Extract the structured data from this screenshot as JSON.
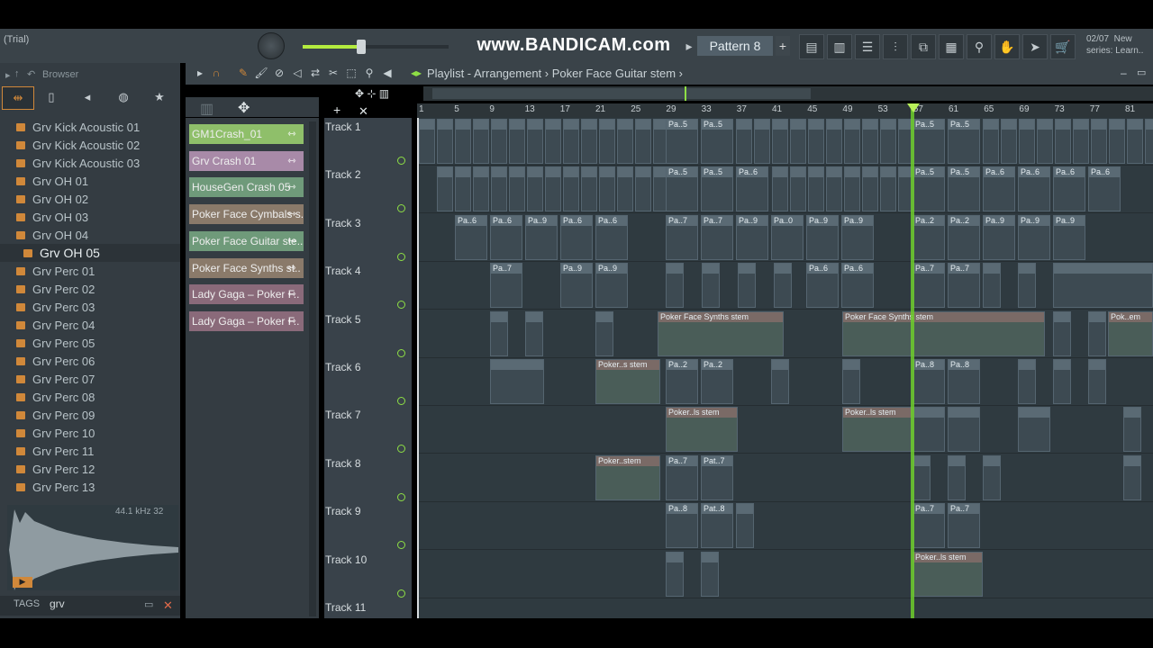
{
  "app": {
    "trial_label": "(Trial)",
    "watermark": "www.BANDICAM.com",
    "pattern_label": "Pattern 8",
    "pattern_plus": "+",
    "news_date": "02/07",
    "news_title": "New",
    "news_sub": "series: Learn.."
  },
  "browser": {
    "title": "Browser",
    "items": [
      "Grv Kick Acoustic 01",
      "Grv Kick Acoustic 02",
      "Grv Kick Acoustic 03",
      "Grv OH 01",
      "Grv OH 02",
      "Grv OH 03",
      "Grv OH 04",
      "Grv OH 05",
      "Grv Perc 01",
      "Grv Perc 02",
      "Grv Perc 03",
      "Grv Perc 04",
      "Grv Perc 05",
      "Grv Perc 06",
      "Grv Perc 07",
      "Grv Perc 08",
      "Grv Perc 09",
      "Grv Perc 10",
      "Grv Perc 11",
      "Grv Perc 12",
      "Grv Perc 13"
    ],
    "selected": "Grv OH 05",
    "sample_info": "44.1 kHz 32",
    "tags_label": "TAGS",
    "search_value": "grv"
  },
  "channels": [
    {
      "label": "GM1Crash_01",
      "color": "#8fbf6a"
    },
    {
      "label": "Grv Crash 01",
      "color": "#a88aa8"
    },
    {
      "label": "HouseGen Crash 05",
      "color": "#6f9a7a"
    },
    {
      "label": "Poker Face Cymbals s..",
      "color": "#8a7a6a"
    },
    {
      "label": "Poker Face Guitar ste..",
      "color": "#6f9a7a"
    },
    {
      "label": "Poker Face Synths st..",
      "color": "#8a7a6a"
    },
    {
      "label": "Lady Gaga – Poker F..",
      "color": "#8a6a7a"
    },
    {
      "label": "Lady Gaga – Poker F..",
      "color": "#8a6a7a"
    }
  ],
  "playlist": {
    "title": "Playlist - Arrangement",
    "crumb": "Poker Face Guitar stem",
    "ruler": [
      "1",
      "5",
      "9",
      "13",
      "17",
      "21",
      "25",
      "29",
      "33",
      "37",
      "41",
      "45",
      "49",
      "53",
      "57",
      "61",
      "65",
      "69",
      "73",
      "77",
      "81"
    ],
    "tracks": [
      "Track 1",
      "Track 2",
      "Track 3",
      "Track 4",
      "Track 5",
      "Track 6",
      "Track 7",
      "Track 8",
      "Track 9",
      "Track 10",
      "Track 11"
    ],
    "clip_labels": {
      "synths": "Poker Face Synths stem",
      "synths_short": "Pok..em",
      "stem_s": "Poker..s stem",
      "stem_ls": "Poker..ls stem",
      "stem_plain": "Poker..stem",
      "pa5": "Pa..5",
      "pa6": "Pa..6",
      "pa7": "Pa..7",
      "pa9": "Pa..9",
      "pa2": "Pa..2",
      "pa8": "Pa..8",
      "pa0": "Pa..0",
      "pat7": "Pat..7",
      "pat8": "Pat..8"
    }
  },
  "colors": {
    "accent_green": "#6dcc2c",
    "folder_orange": "#d0883a"
  }
}
